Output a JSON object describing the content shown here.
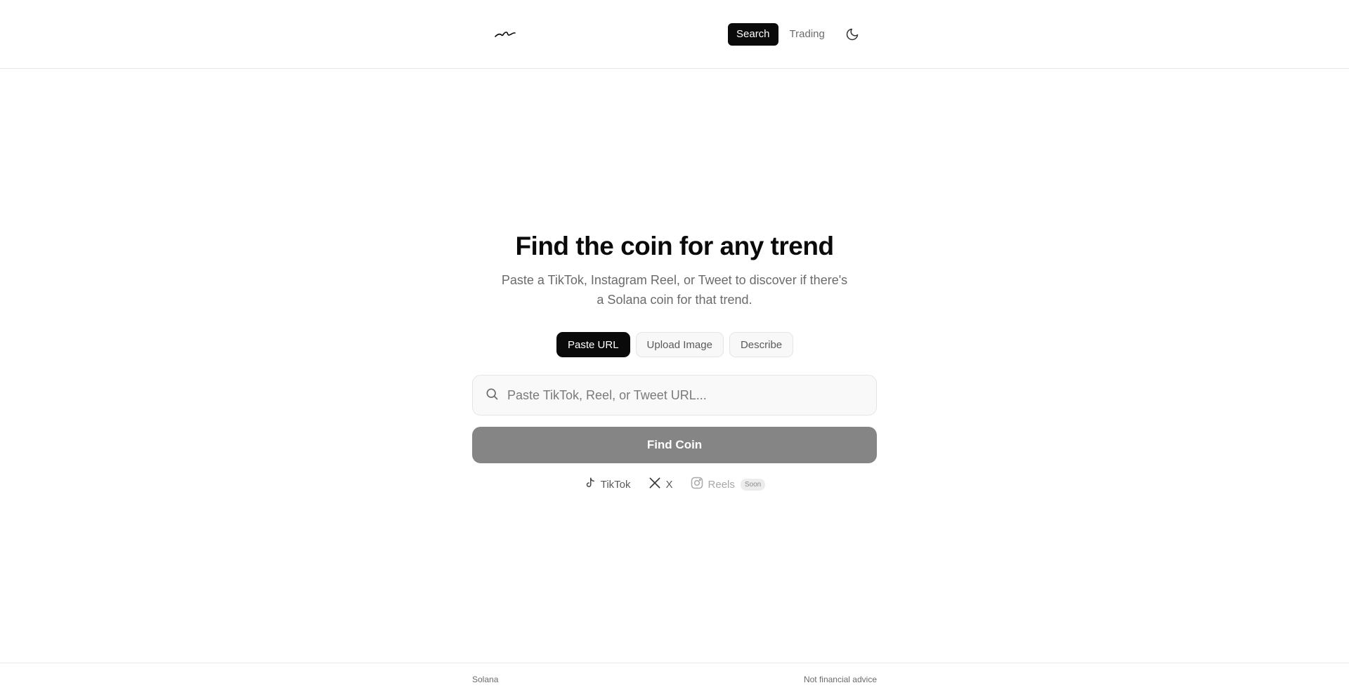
{
  "header": {
    "logo_icon": "wave-logo-icon",
    "nav": [
      {
        "label": "Search",
        "active": true
      },
      {
        "label": "Trading",
        "active": false
      }
    ],
    "theme_icon": "moon-icon"
  },
  "hero": {
    "title": "Find the coin for any trend",
    "subtitle": "Paste a TikTok, Instagram Reel, or Tweet to discover if there's a Solana coin for that trend."
  },
  "modes": [
    {
      "label": "Paste URL",
      "active": true
    },
    {
      "label": "Upload Image",
      "active": false
    },
    {
      "label": "Describe",
      "active": false
    }
  ],
  "search": {
    "icon": "search-icon",
    "placeholder": "Paste TikTok, Reel, or Tweet URL...",
    "value": ""
  },
  "find_button": {
    "label": "Find Coin"
  },
  "platforms": [
    {
      "icon": "tiktok-icon",
      "label": "TikTok",
      "enabled": true
    },
    {
      "icon": "x-icon",
      "label": "X",
      "enabled": true
    },
    {
      "icon": "instagram-icon",
      "label": "Reels",
      "enabled": false,
      "badge": "Soon"
    }
  ],
  "footer": {
    "left": "Solana",
    "right": "Not financial advice"
  },
  "colors": {
    "primary": "#0a0a0a",
    "button_disabled": "#858585",
    "muted_text": "#6b6b6b",
    "border": "#e5e5e5"
  }
}
